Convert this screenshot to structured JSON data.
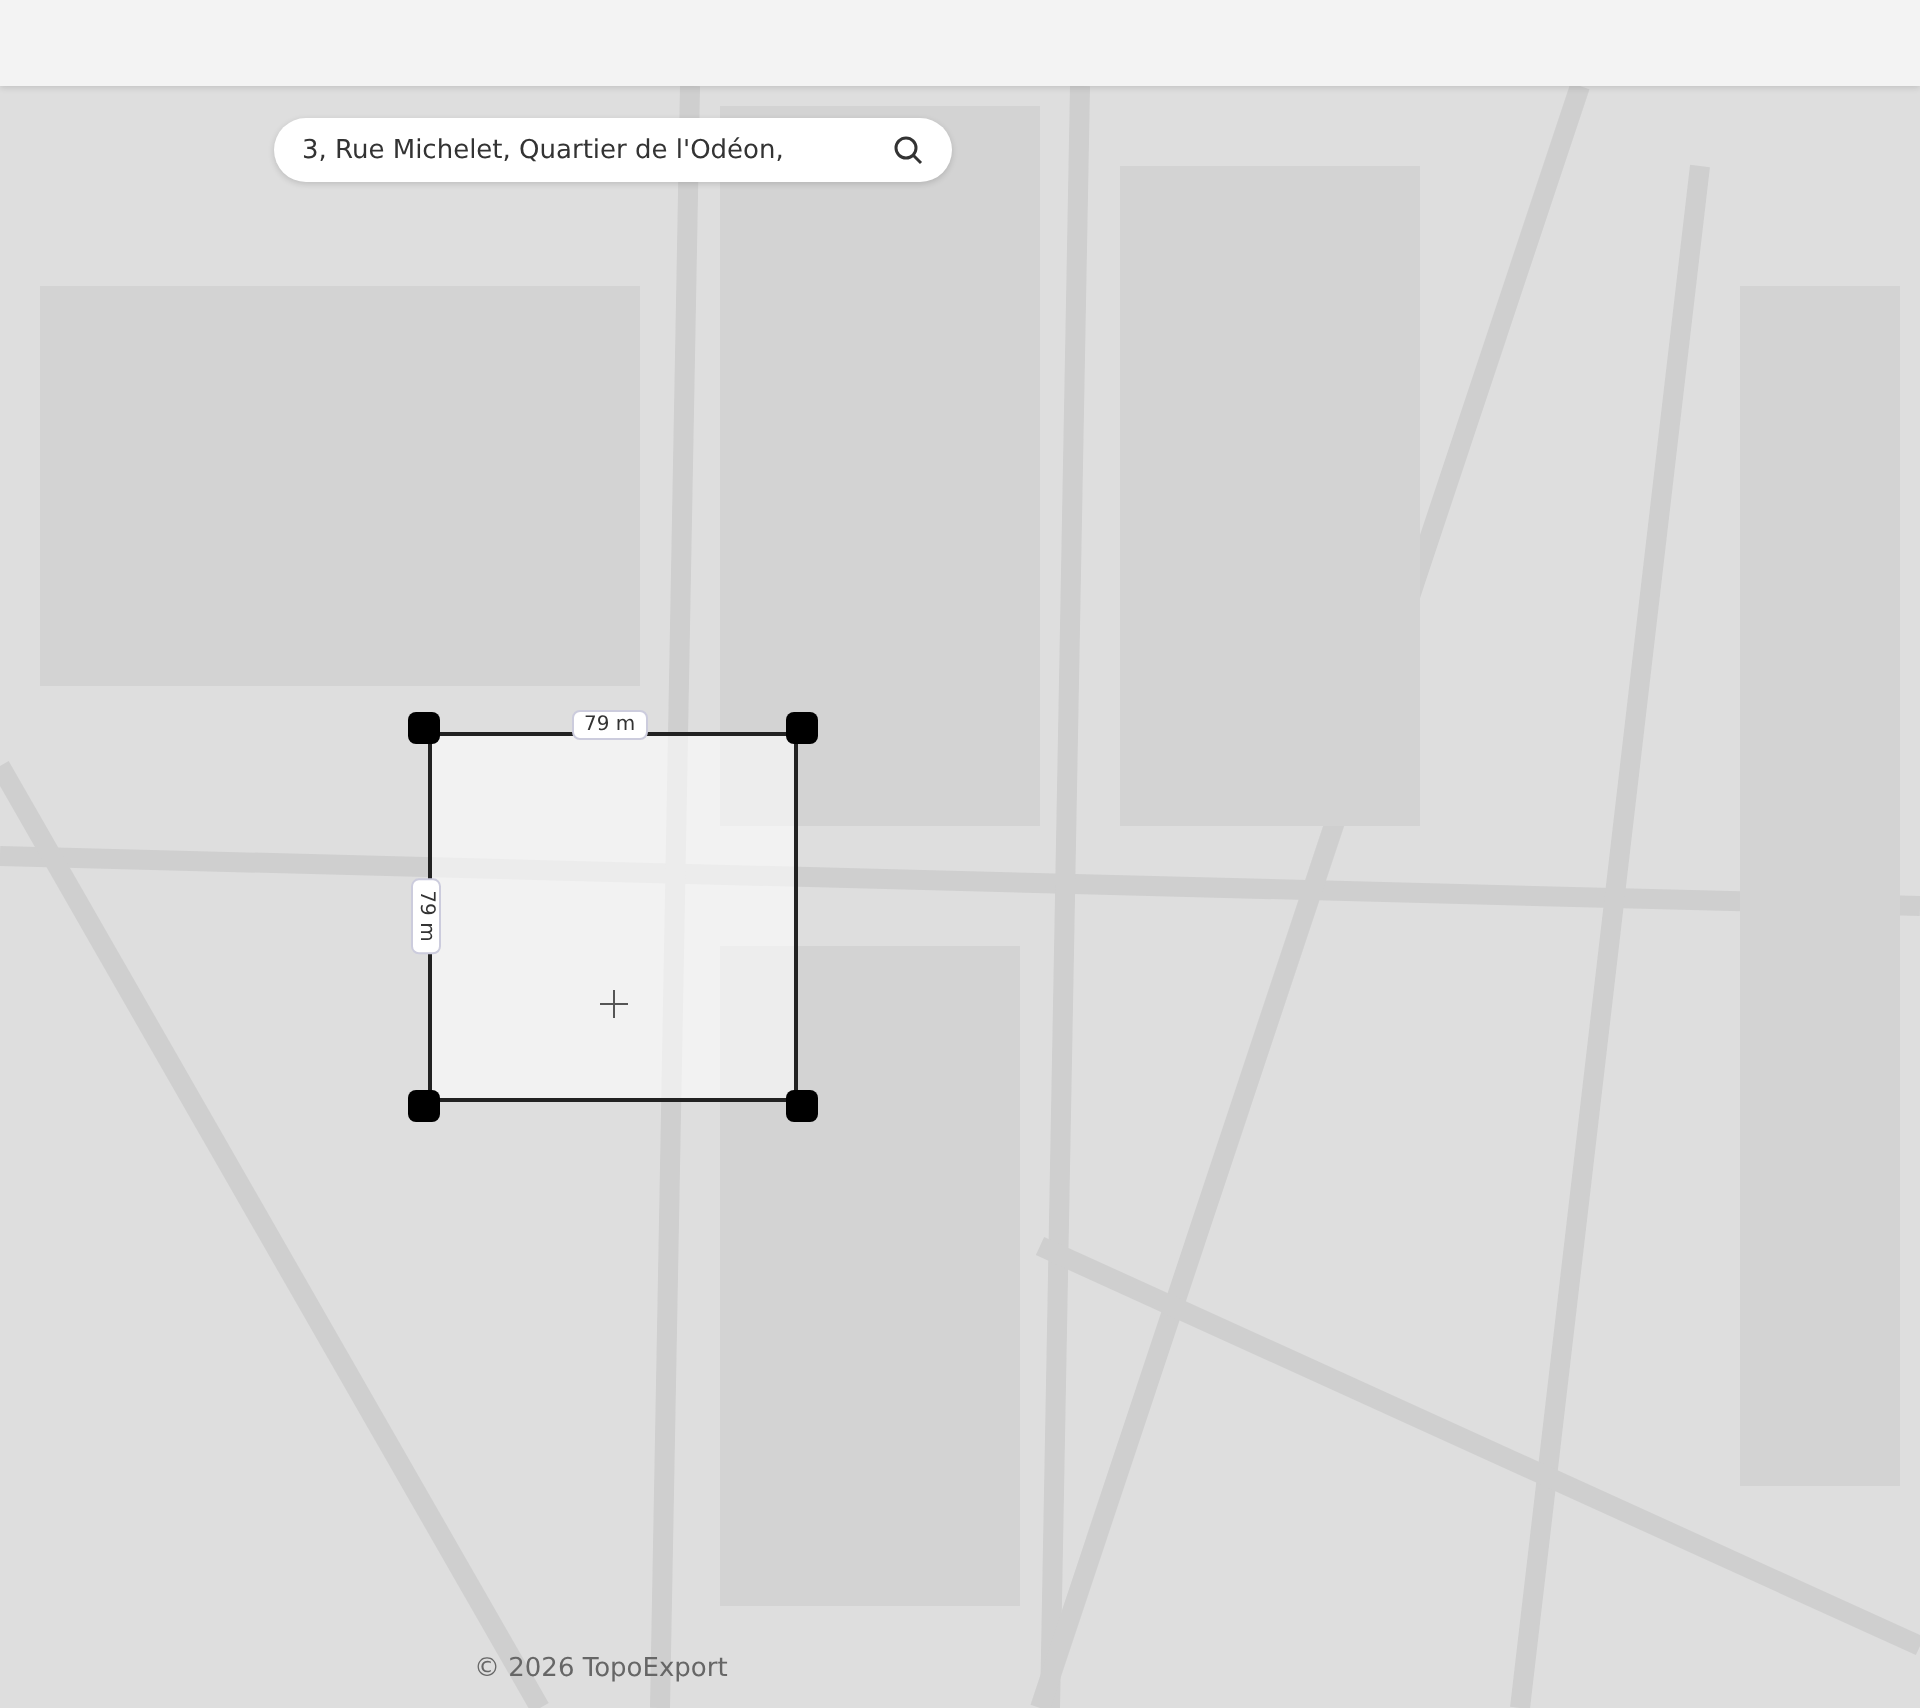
{
  "search": {
    "value": "3, Rue Michelet, Quartier de l'Odéon,"
  },
  "selection": {
    "width_label": "79 m",
    "height_label": "79 m"
  },
  "footer": {
    "copyright": "© 2026 TopoExport"
  }
}
